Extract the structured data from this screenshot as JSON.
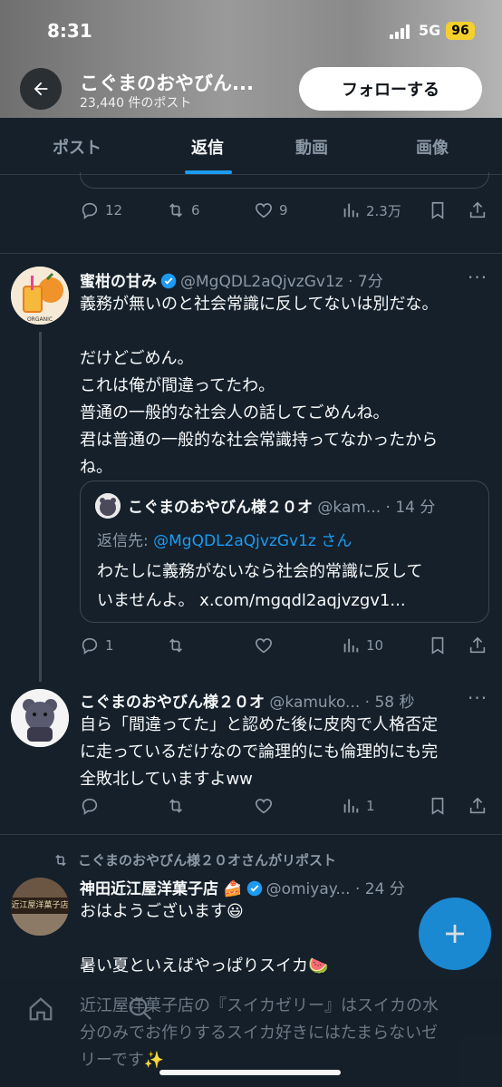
{
  "status_bar": {
    "time": "8:31",
    "network": "5G",
    "battery": "96"
  },
  "header": {
    "name": "こぐまのおやびん...",
    "post_count": "23,440 件のポスト",
    "follow_label": "フォローする"
  },
  "tabs": [
    {
      "label": "ポスト",
      "active": false
    },
    {
      "label": "返信",
      "active": true
    },
    {
      "label": "動画",
      "active": false
    },
    {
      "label": "画像",
      "active": false
    }
  ],
  "first_actions": {
    "replies": "12",
    "reposts": "6",
    "likes": "9",
    "views": "2.3万"
  },
  "tweet1": {
    "name": "蜜柑の甘み",
    "handle_time": "@MgQDL2aQjvzGv1z · 7分",
    "text": "義務が無いのと社会常識に反してないは別だな。\n\nだけどごめん。\nこれは俺が間違ってたわ。\n普通の一般的な社会人の話してごめんね。\n君は普通の一般的な社会常識持ってなかったから\nね。",
    "quote": {
      "name": "こぐまのおやびん様２０オ",
      "handle_time": "@kam... · 14 分",
      "reply_prefix": "返信先: ",
      "reply_to": "@MgQDL2aQjvzGv1z さん",
      "text": "わたしに義務がないなら社会的常識に反して\nいませんよ。 x.com/mgqdl2aqjvzgv1..."
    },
    "actions": {
      "replies": "1",
      "reposts": "",
      "likes": "",
      "views": "10"
    }
  },
  "tweet2": {
    "name": "こぐまのおやびん様２０オ",
    "handle_time": "@kamuko... · 58 秒",
    "text": "自ら「間違ってた」と認めた後に皮肉で人格否定\nに走っているだけなので論理的にも倫理的にも完\n全敗北していますよww",
    "actions": {
      "replies": "",
      "reposts": "",
      "likes": "",
      "views": "1"
    }
  },
  "repost_label": "こぐまのおやびん様２０オさんがリポスト",
  "tweet3": {
    "name": "神田近江屋洋菓子店",
    "emoji": "🍰",
    "handle_time": "@omiyay... · 24 分",
    "text": "おはようございます😃\n\n暑い夏といえばやっぱりスイカ🍉",
    "avatar_text": "近江屋洋菓子店"
  },
  "bottom_text": "近江屋洋菓子店の『スイカゼリー』はスイカの水\n分のみでお作りするスイカ好きにはたまらないゼ\nリーです✨",
  "colors": {
    "accent": "#1d9bf0",
    "background": "#15202b",
    "muted": "#8b98a5"
  }
}
